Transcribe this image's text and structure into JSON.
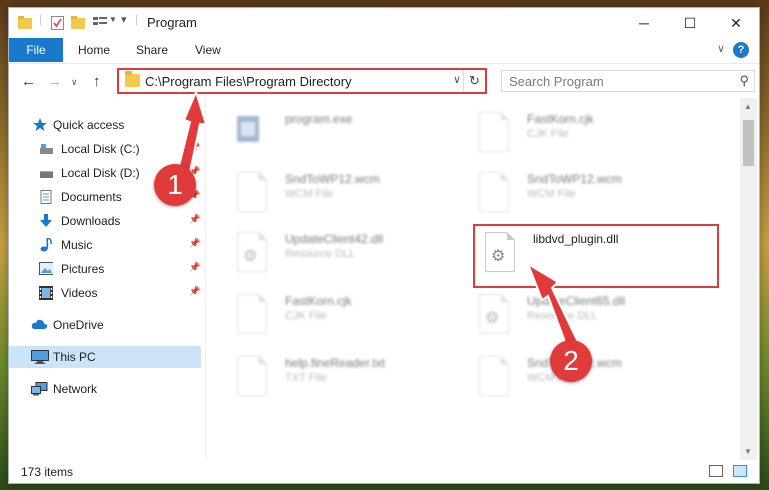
{
  "window": {
    "title": "Program"
  },
  "ribbon": {
    "tabs": [
      "File",
      "Home",
      "Share",
      "View"
    ]
  },
  "nav": {
    "address": "C:\\Program Files\\Program Directory",
    "search_placeholder": "Search Program"
  },
  "sidebar": {
    "items": [
      {
        "label": "Quick access",
        "icon": "star-icon",
        "pinned": false
      },
      {
        "label": "Local Disk (C:)",
        "icon": "drive-icon",
        "pinned": true
      },
      {
        "label": "Local Disk (D:)",
        "icon": "drive-icon",
        "pinned": true
      },
      {
        "label": "Documents",
        "icon": "documents-icon",
        "pinned": true
      },
      {
        "label": "Downloads",
        "icon": "download-icon",
        "pinned": true
      },
      {
        "label": "Music",
        "icon": "music-icon",
        "pinned": true
      },
      {
        "label": "Pictures",
        "icon": "pictures-icon",
        "pinned": true
      },
      {
        "label": "Videos",
        "icon": "videos-icon",
        "pinned": true
      },
      {
        "label": "OneDrive",
        "icon": "cloud-icon",
        "pinned": false
      },
      {
        "label": "This PC",
        "icon": "computer-icon",
        "pinned": false
      },
      {
        "label": "Network",
        "icon": "network-icon",
        "pinned": false
      }
    ]
  },
  "files": [
    {
      "name": "program.exe",
      "type": ""
    },
    {
      "name": "FastKorn.cjk",
      "type": "CJK File"
    },
    {
      "name": "SndToWP12.wcm",
      "type": "WCM File"
    },
    {
      "name": "SndToWP12.wcm",
      "type": "WCM File"
    },
    {
      "name": "UpdateClient42.dll",
      "type": "Resource DLL"
    },
    {
      "name": "libdvd_plugin.dll",
      "type": ""
    },
    {
      "name": "FastKorn.cjk",
      "type": "CJK File"
    },
    {
      "name": "UpdateClient65.dll",
      "type": "Resource DLL"
    },
    {
      "name": "help.fineReader.txt",
      "type": "TXT File"
    },
    {
      "name": "SndToWP12.wcm",
      "type": "WCM File"
    }
  ],
  "status": {
    "count": "173 items"
  },
  "annotations": {
    "step1": "1",
    "step2": "2",
    "color": "#e03a3a"
  }
}
